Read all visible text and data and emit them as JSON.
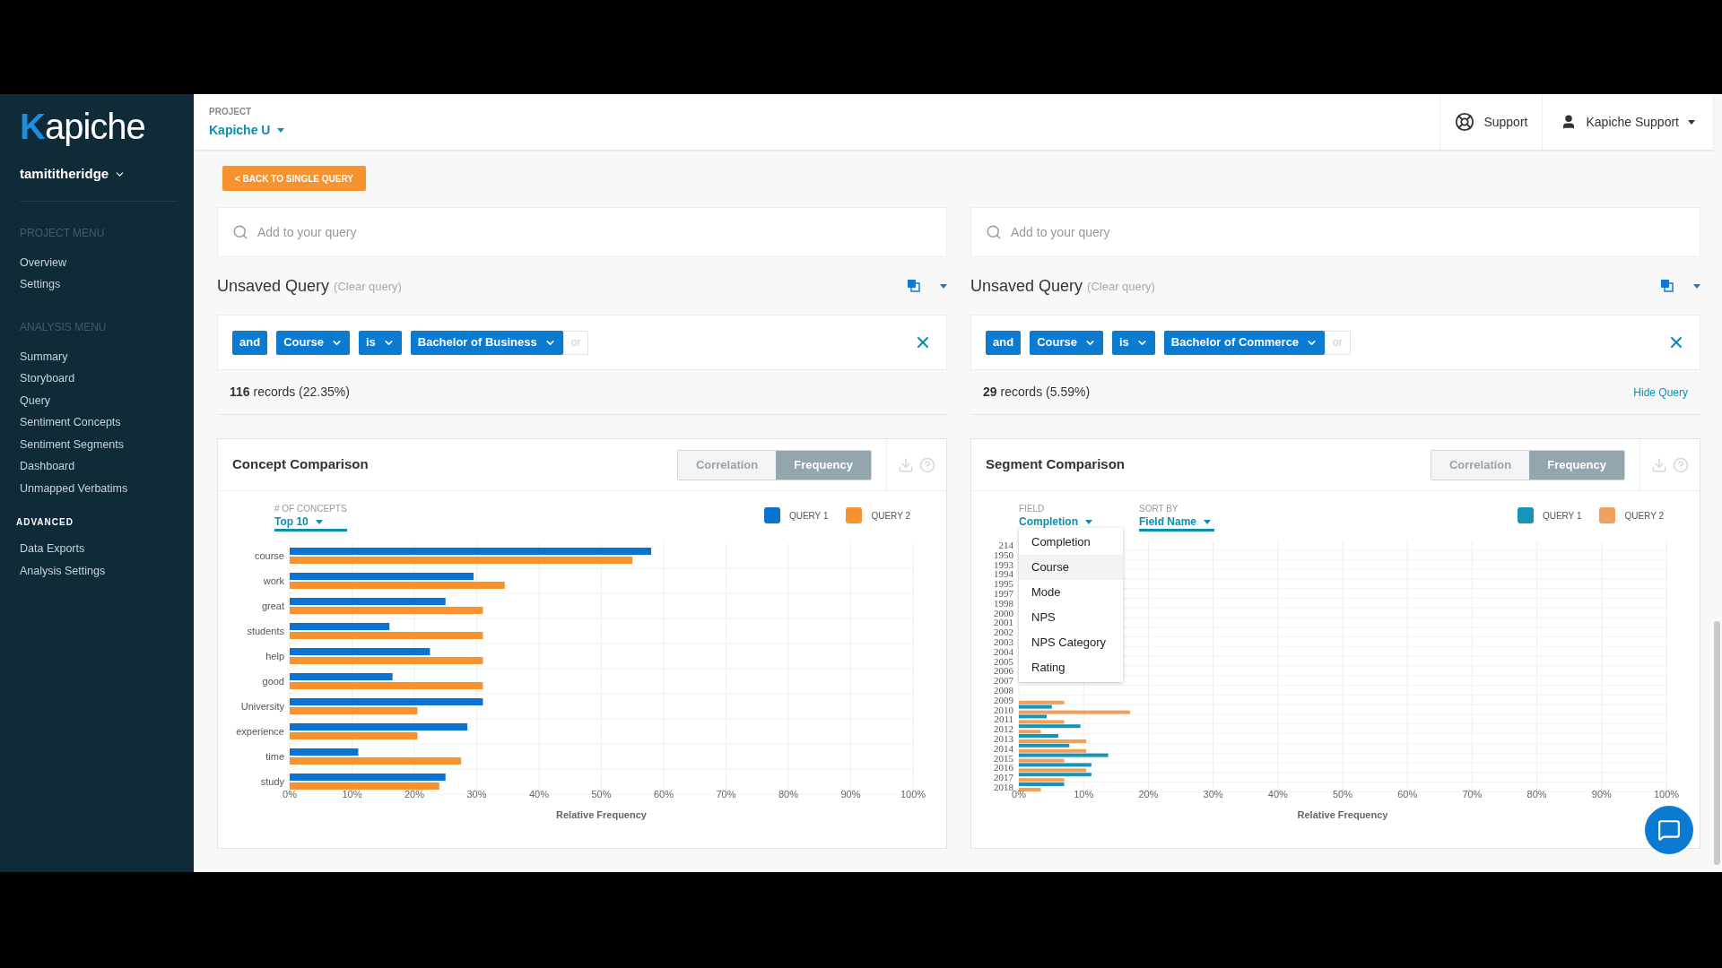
{
  "sidebar": {
    "logo": "Kapiche",
    "user": "tamititheridge",
    "sections": [
      {
        "heading": "PROJECT MENU",
        "kind": "muted",
        "items": [
          "Overview",
          "Settings"
        ]
      },
      {
        "heading": "ANALYSIS MENU",
        "kind": "muted",
        "items": [
          "Summary",
          "Storyboard",
          "Query",
          "Sentiment Concepts",
          "Sentiment Segments",
          "Dashboard",
          "Unmapped Verbatims"
        ]
      },
      {
        "heading": "ADVANCED",
        "kind": "strong",
        "items": [
          "Data Exports",
          "Analysis Settings"
        ]
      }
    ]
  },
  "header": {
    "project_label": "PROJECT",
    "project": "Kapiche U",
    "support": "Support",
    "account": "Kapiche Support"
  },
  "back_button": "< BACK TO SINGLE QUERY",
  "queries": [
    {
      "placeholder": "Add to your query",
      "title": "Unsaved Query",
      "clear": "(Clear query)",
      "chips": [
        {
          "text": "and",
          "dropdown": false
        },
        {
          "text": "Course",
          "dropdown": true
        },
        {
          "text": "is",
          "dropdown": true
        },
        {
          "text": "Bachelor of Business",
          "dropdown": true
        }
      ],
      "or": "or",
      "records": "**116** records (22.35%)"
    },
    {
      "placeholder": "Add to your query",
      "title": "Unsaved Query",
      "clear": "(Clear query)",
      "chips": [
        {
          "text": "and",
          "dropdown": false
        },
        {
          "text": "Course",
          "dropdown": true
        },
        {
          "text": "is",
          "dropdown": true
        },
        {
          "text": "Bachelor of Commerce",
          "dropdown": true
        }
      ],
      "or": "or",
      "records": "**29** records (5.59%)",
      "hide_link": "Hide Query"
    }
  ],
  "panels": [
    {
      "title": "Concept Comparison",
      "toggle": [
        {
          "label": "Correlation",
          "selected": false
        },
        {
          "label": "Frequency",
          "selected": true
        }
      ],
      "controls": [
        {
          "label": "# OF CONCEPTS",
          "value": "Top 10"
        }
      ],
      "chart_data": {
        "type": "bar",
        "orientation": "horizontal",
        "grid": true,
        "xlabel": "Relative Frequency",
        "categories": [
          "course",
          "work",
          "great",
          "students",
          "help",
          "good",
          "University",
          "experience",
          "time",
          "study"
        ],
        "series": [
          {
            "name": "QUERY 1",
            "color": "#0a72d0",
            "values": [
              58,
              29.5,
              25,
              16,
              22.5,
              16.5,
              31,
              28.5,
              11,
              25
            ]
          },
          {
            "name": "QUERY 2",
            "color": "#f7922f",
            "values": [
              55,
              34.5,
              31,
              31,
              31,
              31,
              20.5,
              20.5,
              27.5,
              24
            ]
          }
        ],
        "xlim": [
          0,
          100
        ],
        "xticks": [
          {
            "value": 0,
            "label": "0%"
          },
          {
            "value": 10,
            "label": "10%"
          },
          {
            "value": 20,
            "label": "20%"
          },
          {
            "value": 30,
            "label": "30%"
          },
          {
            "value": 40,
            "label": "40%"
          },
          {
            "value": 50,
            "label": "50%"
          },
          {
            "value": 60,
            "label": "60%"
          },
          {
            "value": 70,
            "label": "70%"
          },
          {
            "value": 80,
            "label": "80%"
          },
          {
            "value": 90,
            "label": "90%"
          },
          {
            "value": 100,
            "label": "100%"
          }
        ]
      }
    },
    {
      "title": "Segment Comparison",
      "toggle": [
        {
          "label": "Correlation",
          "selected": false
        },
        {
          "label": "Frequency",
          "selected": true
        }
      ],
      "controls": [
        {
          "label": "FIELD",
          "value": "Completion",
          "menu": [
            {
              "label": "Completion",
              "highlighted": false
            },
            {
              "label": "Course",
              "highlighted": true
            },
            {
              "label": "Mode",
              "highlighted": false
            },
            {
              "label": "NPS",
              "highlighted": false
            },
            {
              "label": "NPS Category",
              "highlighted": false
            },
            {
              "label": "Rating",
              "highlighted": false
            }
          ]
        },
        {
          "label": "SORT BY",
          "value": "Field Name"
        }
      ],
      "chart_data": {
        "type": "bar",
        "orientation": "horizontal",
        "grid": true,
        "xlabel": "Relative Frequency",
        "categories": [
          "214",
          "1950",
          "1993",
          "1994",
          "1995",
          "1997",
          "1998",
          "2000",
          "2001",
          "2002",
          "2003",
          "2004",
          "2005",
          "2006",
          "2007",
          "2008",
          "2009",
          "2010",
          "2011",
          "2012",
          "2013",
          "2014",
          "2015",
          "2016",
          "2017",
          "2018"
        ],
        "series": [
          {
            "name": "QUERY 1",
            "color": "#1495b8",
            "values": [
              null,
              null,
              null,
              null,
              null,
              null,
              null,
              null,
              null,
              null,
              null,
              null,
              null,
              null,
              null,
              null,
              null,
              5.1,
              4.3,
              9.5,
              6.1,
              7.8,
              13.8,
              11.2,
              11.2,
              7
            ]
          },
          {
            "name": "QUERY 2",
            "color": "#f0a05a",
            "values": [
              null,
              null,
              null,
              null,
              null,
              null,
              null,
              null,
              null,
              null,
              null,
              null,
              null,
              null,
              null,
              null,
              7,
              17.2,
              7,
              3.4,
              10.4,
              10.4,
              7,
              10.4,
              7,
              3.4
            ]
          }
        ],
        "xlim": [
          0,
          100
        ],
        "xticks": [
          {
            "value": 0,
            "label": "0%"
          },
          {
            "value": 10,
            "label": "10%"
          },
          {
            "value": 20,
            "label": "20%"
          },
          {
            "value": 30,
            "label": "30%"
          },
          {
            "value": 40,
            "label": "40%"
          },
          {
            "value": 50,
            "label": "50%"
          },
          {
            "value": 60,
            "label": "60%"
          },
          {
            "value": 70,
            "label": "70%"
          },
          {
            "value": 80,
            "label": "80%"
          },
          {
            "value": 90,
            "label": "90%"
          },
          {
            "value": 100,
            "label": "100%"
          }
        ]
      }
    }
  ]
}
